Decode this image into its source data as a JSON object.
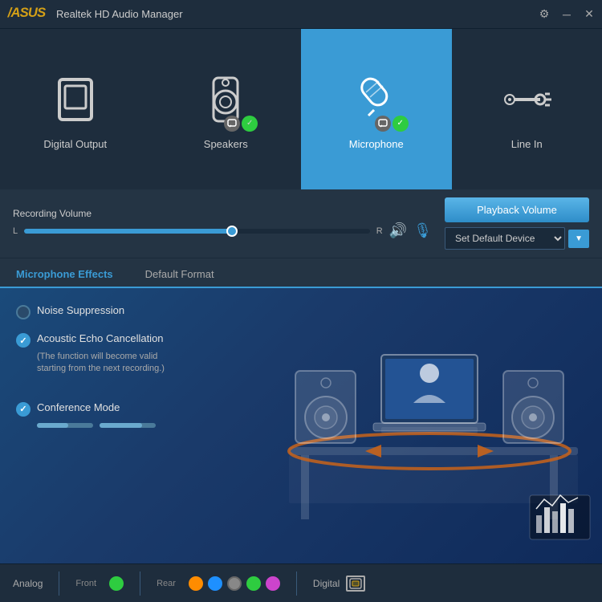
{
  "titlebar": {
    "logo": "/Asus",
    "title": "Realtek HD Audio Manager",
    "controls": {
      "settings": "⚙",
      "minimize": "─",
      "close": "✕"
    }
  },
  "tabs": [
    {
      "id": "digital-output",
      "label": "Digital Output",
      "active": false,
      "has_badges": false
    },
    {
      "id": "speakers",
      "label": "Speakers",
      "active": false,
      "has_badges": true
    },
    {
      "id": "microphone",
      "label": "Microphone",
      "active": true,
      "has_badges": true
    },
    {
      "id": "line-in",
      "label": "Line In",
      "active": false,
      "has_badges": false
    }
  ],
  "volume": {
    "recording_label": "Recording Volume",
    "left_label": "L",
    "right_label": "R",
    "playback_button": "Playback Volume",
    "default_device_label": "Set Default Device",
    "slider_percent": 60
  },
  "effect_tabs": [
    {
      "id": "mic-effects",
      "label": "Microphone Effects",
      "active": true
    },
    {
      "id": "default-format",
      "label": "Default Format",
      "active": false
    }
  ],
  "effects": [
    {
      "id": "noise-suppression",
      "label": "Noise Suppression",
      "checked": false,
      "sublabel": ""
    },
    {
      "id": "acoustic-echo",
      "label": "Acoustic Echo Cancellation",
      "checked": true,
      "sublabel": "(The function will become valid\nstarting from the next recording.)"
    },
    {
      "id": "conference-mode",
      "label": "Conference Mode",
      "checked": true,
      "sublabel": ""
    }
  ],
  "statusbar": {
    "analog_label": "Analog",
    "front_label": "Front",
    "rear_label": "Rear",
    "digital_label": "Digital",
    "front_dots": [
      {
        "color": "#2ecc40"
      }
    ],
    "rear_dots": [
      {
        "color": "#ff8c00"
      },
      {
        "color": "#1e90ff"
      },
      {
        "color": "#888"
      },
      {
        "color": "#2ecc40"
      },
      {
        "color": "#cc44cc"
      }
    ]
  }
}
